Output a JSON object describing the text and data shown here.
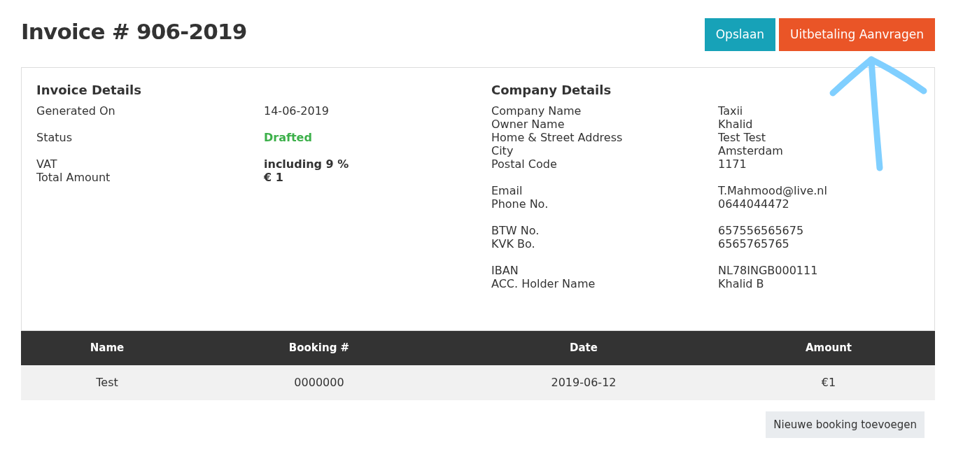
{
  "title": "Invoice # 906-2019",
  "buttons": [
    {
      "label": "Opslaan",
      "kind": "save"
    },
    {
      "label": "Uitbetaling Aanvragen",
      "kind": "payout"
    }
  ],
  "invoice_details": {
    "heading": "Invoice Details",
    "groups": [
      [
        {
          "label": "Generated On",
          "value": "14-06-2019",
          "kind": "plain"
        }
      ],
      [
        {
          "label": "Status",
          "value": "Drafted",
          "kind": "status"
        }
      ],
      [
        {
          "label": "VAT",
          "value": "including 9 %",
          "kind": "bold"
        },
        {
          "label": "Total Amount",
          "value": "€ 1",
          "kind": "bold"
        }
      ]
    ]
  },
  "company_details": {
    "heading": "Company Details",
    "groups": [
      [
        {
          "label": "Company Name",
          "value": "Taxii"
        },
        {
          "label": "Owner Name",
          "value": "Khalid"
        },
        {
          "label": "Home & Street Address",
          "value": "Test Test"
        },
        {
          "label": "City",
          "value": "Amsterdam"
        },
        {
          "label": "Postal Code",
          "value": "1171"
        }
      ],
      [
        {
          "label": "Email",
          "value": "T.Mahmood@live.nl"
        },
        {
          "label": "Phone No.",
          "value": "0644044472"
        }
      ],
      [
        {
          "label": "BTW No.",
          "value": "657556565675"
        },
        {
          "label": "KVK Bo.",
          "value": "6565765765"
        }
      ],
      [
        {
          "label": "IBAN",
          "value": "NL78INGB000111"
        },
        {
          "label": "ACC. Holder Name",
          "value": "Khalid B"
        }
      ]
    ]
  },
  "table": {
    "columns": [
      "Name",
      "Booking #",
      "Date",
      "Amount"
    ],
    "rows": [
      [
        "Test",
        "0000000",
        "2019-06-12",
        "€1"
      ]
    ]
  },
  "add_button": "Nieuwe booking toevoegen"
}
